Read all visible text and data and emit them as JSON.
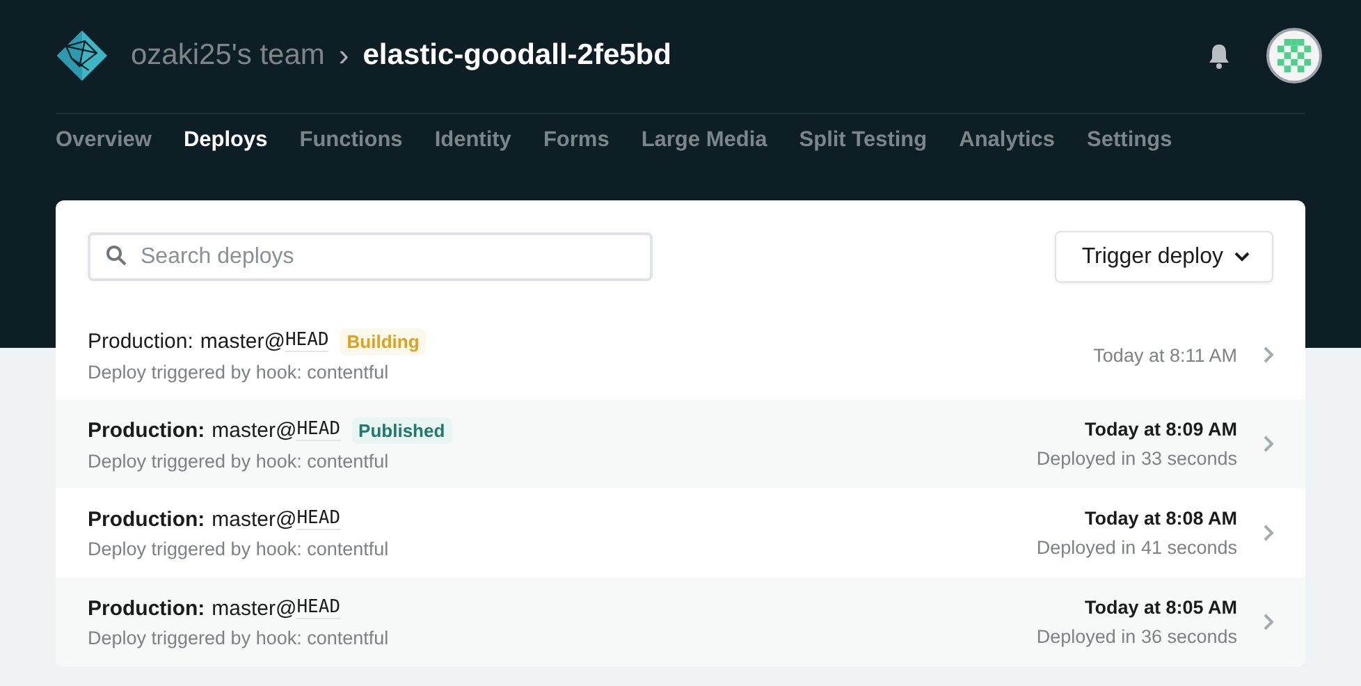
{
  "header": {
    "team": "ozaki25's team",
    "separator": "›",
    "site": "elastic-goodall-2fe5bd"
  },
  "tabs": [
    {
      "label": "Overview",
      "selected": false
    },
    {
      "label": "Deploys",
      "selected": true
    },
    {
      "label": "Functions",
      "selected": false
    },
    {
      "label": "Identity",
      "selected": false
    },
    {
      "label": "Forms",
      "selected": false
    },
    {
      "label": "Large Media",
      "selected": false
    },
    {
      "label": "Split Testing",
      "selected": false
    },
    {
      "label": "Analytics",
      "selected": false
    },
    {
      "label": "Settings",
      "selected": false
    }
  ],
  "search": {
    "placeholder": "Search deploys"
  },
  "trigger_button": "Trigger deploy",
  "deploys": [
    {
      "context": "Production:",
      "branch": "master@",
      "ref": "HEAD",
      "badge": {
        "label": "Building",
        "kind": "building"
      },
      "description": "Deploy triggered by hook: contentful",
      "time": "Today at 8:11 AM",
      "finished": false
    },
    {
      "context": "Production:",
      "branch": "master@",
      "ref": "HEAD",
      "badge": {
        "label": "Published",
        "kind": "published"
      },
      "description": "Deploy triggered by hook: contentful",
      "time": "Today at 8:09 AM",
      "duration": "Deployed in 33 seconds",
      "finished": true
    },
    {
      "context": "Production:",
      "branch": "master@",
      "ref": "HEAD",
      "description": "Deploy triggered by hook: contentful",
      "time": "Today at 8:08 AM",
      "duration": "Deployed in 41 seconds",
      "finished": true
    },
    {
      "context": "Production:",
      "branch": "master@",
      "ref": "HEAD",
      "description": "Deploy triggered by hook: contentful",
      "time": "Today at 8:05 AM",
      "duration": "Deployed in 36 seconds",
      "finished": true
    }
  ]
}
